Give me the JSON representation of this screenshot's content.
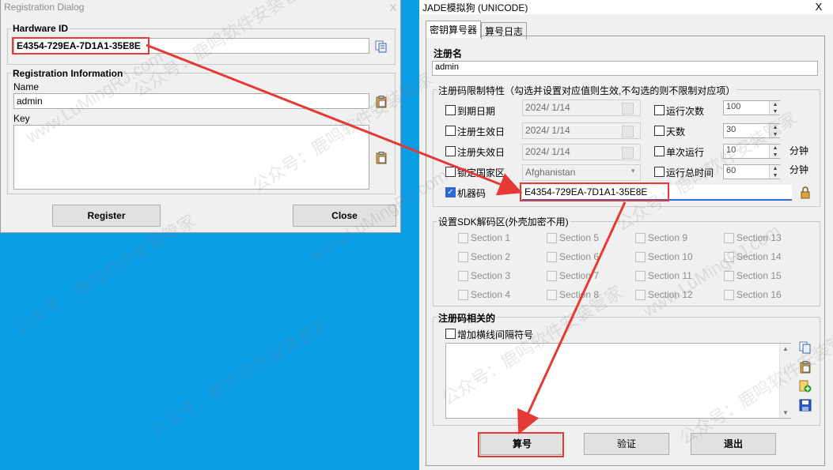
{
  "reg_dialog": {
    "title": "Registration Dialog",
    "close_glyph": "X",
    "hardware_id_group": "Hardware ID",
    "hardware_id_value": "E4354-729EA-7D1A1-35E8E",
    "reg_info_group": "Registration Information",
    "name_label": "Name",
    "name_value": "admin",
    "key_label": "Key",
    "key_value": "",
    "register_label": "Register",
    "close_label": "Close"
  },
  "jade": {
    "title": "JADE模拟狗 (UNICODE)",
    "close_glyph": "X",
    "tabs": [
      "密钥算号器",
      "算号日志"
    ],
    "reg_name_label": "注册名",
    "reg_name_value": "admin",
    "limits_group": "注册码限制特性（勾选并设置对应值则生效,不勾选的则不限制对应项）",
    "limits": {
      "expire_label": "到期日期",
      "expire_value": "2024/ 1/14",
      "start_label": "注册生效日",
      "start_value": "2024/ 1/14",
      "end_label": "注册失效日",
      "end_value": "2024/ 1/14",
      "region_label": "锁定国家区",
      "region_value": "Afghanistan",
      "machine_label": "机器码",
      "machine_value": "E4354-729EA-7D1A1-35E8E",
      "runs_label": "运行次数",
      "runs_value": "100",
      "days_label": "天数",
      "days_value": "30",
      "single_label": "单次运行",
      "single_value": "10",
      "single_unit": "分钟",
      "total_label": "运行总时间",
      "total_value": "60",
      "total_unit": "分钟"
    },
    "sdk_group": "设置SDK解码区(外壳加密不用)",
    "sections": [
      "Section 1",
      "Section 5",
      "Section 9",
      "Section 13",
      "Section 2",
      "Section 6",
      "Section 10",
      "Section 14",
      "Section 3",
      "Section 7",
      "Section 11",
      "Section 15",
      "Section 4",
      "Section 8",
      "Section 12",
      "Section 16"
    ],
    "code_group": "注册码相关的",
    "dash_label": "增加横线间隔符号",
    "buttons": {
      "calc": "算号",
      "verify": "验证",
      "exit": "退出"
    }
  },
  "watermark": {
    "cn": "公众号：鹿鸣软件安装管家",
    "en": "www.LuMingRJ.com"
  },
  "colors": {
    "desktop": "#0a9ee6",
    "highlight": "#e53935",
    "check_blue": "#2a6ad6"
  }
}
